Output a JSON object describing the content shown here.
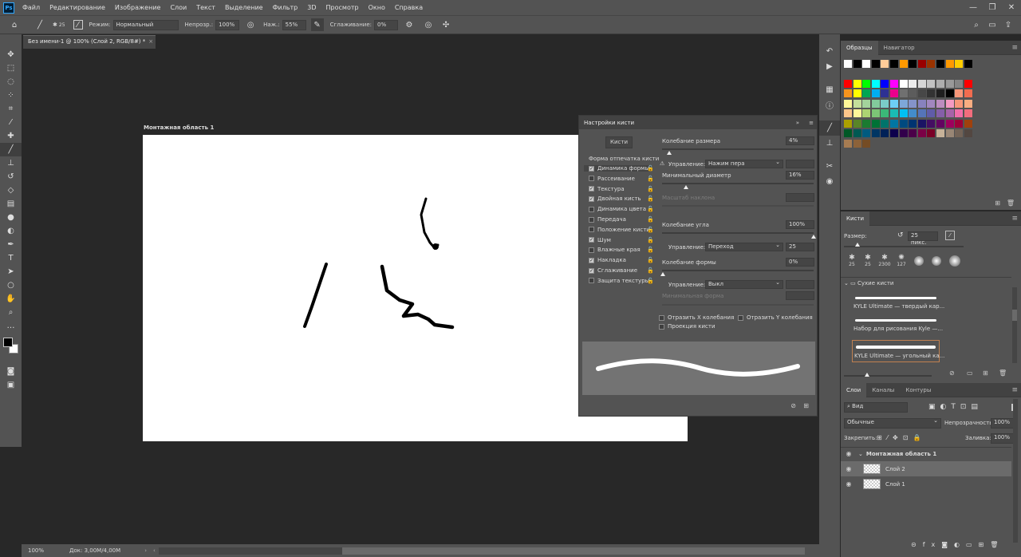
{
  "app": {
    "logo": "Ps"
  },
  "menu": [
    "Файл",
    "Редактирование",
    "Изображение",
    "Слои",
    "Текст",
    "Выделение",
    "Фильтр",
    "3D",
    "Просмотр",
    "Окно",
    "Справка"
  ],
  "options": {
    "brush_size": "25",
    "mode_label": "Режим:",
    "mode_value": "Нормальный",
    "opacity_label": "Непрозр.:",
    "opacity_value": "100%",
    "flow_label": "Наж.:",
    "flow_value": "55%",
    "smoothing_label": "Сглаживание:",
    "smoothing_value": "0%"
  },
  "document": {
    "tab_title": "Без имени-1 @ 100% (Слой 2, RGB/8#) *",
    "artboard_label": "Монтажная область 1"
  },
  "status": {
    "zoom": "100%",
    "doc_info": "Док: 3,00M/4,00M"
  },
  "brush_settings": {
    "title": "Настройки кисти",
    "brushes_button": "Кисти",
    "tip_shape": "Форма отпечатка кисти",
    "options": [
      {
        "label": "Динамика формы",
        "checked": true
      },
      {
        "label": "Рассеивание",
        "checked": false
      },
      {
        "label": "Текстура",
        "checked": true
      },
      {
        "label": "Двойная кисть",
        "checked": true
      },
      {
        "label": "Динамика цвета",
        "checked": false
      },
      {
        "label": "Передача",
        "checked": false
      },
      {
        "label": "Положение кисти",
        "checked": false
      },
      {
        "label": "Шум",
        "checked": true
      },
      {
        "label": "Влажные края",
        "checked": false
      },
      {
        "label": "Накладка",
        "checked": true
      },
      {
        "label": "Сглаживание",
        "checked": true
      },
      {
        "label": "Защита текстуры",
        "checked": false
      }
    ],
    "size_jitter_label": "Колебание размера",
    "size_jitter_value": "4%",
    "control_label": "Управление:",
    "control1_value": "Нажим пера",
    "min_diameter_label": "Минимальный диаметр",
    "min_diameter_value": "16%",
    "tilt_scale_label": "Масштаб наклона",
    "angle_jitter_label": "Колебание угла",
    "angle_jitter_value": "100%",
    "control2_value": "Переход",
    "control2_num": "25",
    "roundness_jitter_label": "Колебание формы",
    "roundness_jitter_value": "0%",
    "control3_value": "Выкл",
    "min_roundness_label": "Минимальная форма",
    "flip_x": "Отразить X колебания",
    "flip_y": "Отразить Y колебания",
    "brush_projection": "Проекция кисти"
  },
  "swatches_panel": {
    "tab1": "Образцы",
    "tab2": "Навигатор"
  },
  "brushes_panel": {
    "tab": "Кисти",
    "size_label": "Размер:",
    "size_value": "25 пикс.",
    "presets": [
      "25",
      "25",
      "2300",
      "127"
    ],
    "folder": "Сухие кисти",
    "items": [
      "KYLE Ultimate — твердый кар...",
      "Набор для рисования Kyle —...",
      "KYLE Ultimate — угольный ка..."
    ]
  },
  "layers_panel": {
    "tabs": [
      "Слои",
      "Каналы",
      "Контуры"
    ],
    "search": "Вид",
    "blend_mode": "Обычные",
    "opacity_label": "Непрозрачность:",
    "opacity_value": "100%",
    "lock_label": "Закрепить:",
    "fill_label": "Заливка:",
    "fill_value": "100%",
    "group": "Монтажная область 1",
    "layers": [
      "Слой 2",
      "Слой 1"
    ]
  },
  "swatch_colors": {
    "row0": [
      "#ffffff",
      "#000000",
      "#ffffff",
      "#000000",
      "#ffcc99",
      "#000000",
      "#ff9900",
      "#000000",
      "#990000",
      "#993300",
      "#000000",
      "#ff9900",
      "#ffcc00",
      "#000000"
    ],
    "row1": [
      "#ff0000",
      "#ffff00",
      "#00ff00",
      "#00ffff",
      "#0000ff",
      "#ff00ff",
      "#ffffff",
      "#ebebeb",
      "#d6d6d6",
      "#c2c2c2",
      "#adadad",
      "#999999",
      "#858585",
      "#ff0000"
    ],
    "row2": [
      "#f7941d",
      "#ffff00",
      "#00a651",
      "#00aeef",
      "#2e3192",
      "#ec008c",
      "#707070",
      "#5c5c5c",
      "#474747",
      "#333333",
      "#1f1f1f",
      "#000000",
      "#f69679",
      "#f26c4f"
    ],
    "row3": [
      "#fff799",
      "#c4df9b",
      "#a3d39c",
      "#82ca9c",
      "#7accc8",
      "#6dcff6",
      "#7ea7d8",
      "#8493ca",
      "#8882be",
      "#a187be",
      "#bc8dbf",
      "#f49ac2",
      "#f7977a",
      "#f9ad81"
    ],
    "row4": [
      "#fdc68a",
      "#fff79a",
      "#acd372",
      "#7cc576",
      "#3bb878",
      "#1abbb4",
      "#00bff3",
      "#438ccb",
      "#5574b9",
      "#605ca8",
      "#855fa8",
      "#a763a8",
      "#f06ea9",
      "#f26d7d"
    ],
    "row5": [
      "#aba000",
      "#598527",
      "#1a7b30",
      "#007236",
      "#00746b",
      "#0076a3",
      "#004a80",
      "#003471",
      "#1b1464",
      "#440e62",
      "#630460",
      "#9e005d",
      "#9e0039",
      "#a0410d"
    ],
    "row6": [
      "#005826",
      "#005952",
      "#005b7f",
      "#003663",
      "#002157",
      "#0d004c",
      "#32004b",
      "#4b0049",
      "#7b0046",
      "#7a0026",
      "#c7b299",
      "#998675",
      "#736357",
      "#534741"
    ],
    "row7": [
      "#a67c52",
      "#8c6239",
      "#754c24"
    ]
  }
}
